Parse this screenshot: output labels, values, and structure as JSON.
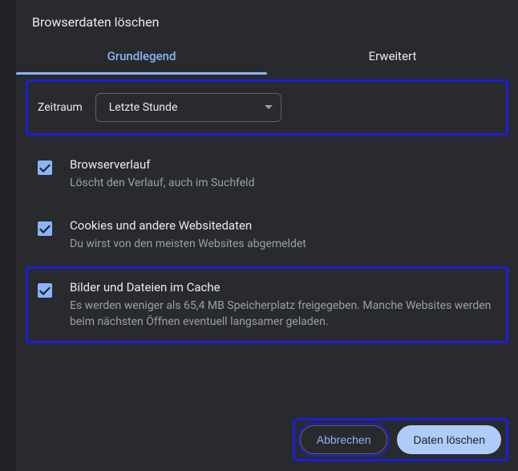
{
  "dialog": {
    "title": "Browserdaten löschen"
  },
  "tabs": {
    "basic": "Grundlegend",
    "advanced": "Erweitert"
  },
  "time": {
    "label": "Zeitraum",
    "selected": "Letzte Stunde"
  },
  "options": [
    {
      "title": "Browserverlauf",
      "desc": "Löscht den Verlauf, auch im Suchfeld",
      "checked": true,
      "highlight": false
    },
    {
      "title": "Cookies und andere Websitedaten",
      "desc": "Du wirst von den meisten Websites abgemeldet",
      "checked": true,
      "highlight": false
    },
    {
      "title": "Bilder und Dateien im Cache",
      "desc": "Es werden weniger als 65,4 MB Speicherplatz freigegeben. Manche Websites werden beim nächsten Öffnen eventuell langsamer geladen.",
      "checked": true,
      "highlight": true
    }
  ],
  "buttons": {
    "cancel": "Abbrechen",
    "clear": "Daten löschen"
  }
}
